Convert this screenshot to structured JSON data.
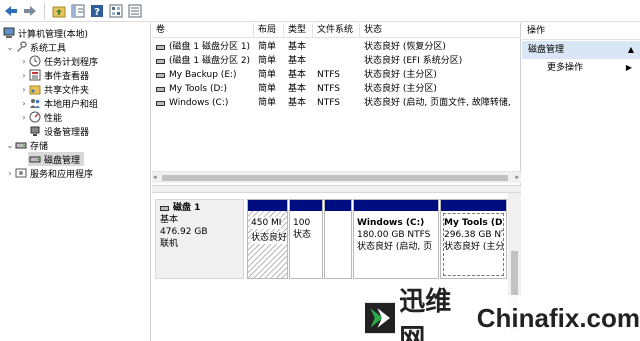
{
  "toolbar": {
    "icons": [
      "back-icon",
      "forward-icon",
      "up-folder-icon",
      "show-hide-tree-icon",
      "help-icon",
      "properties-icon",
      "view-icon"
    ]
  },
  "tree": {
    "root": "计算机管理(本地)",
    "system_tools": "系统工具",
    "task_scheduler": "任务计划程序",
    "event_viewer": "事件查看器",
    "shared_folders": "共享文件夹",
    "local_users": "本地用户和组",
    "performance": "性能",
    "device_manager": "设备管理器",
    "storage": "存储",
    "disk_management": "磁盘管理",
    "services_apps": "服务和应用程序"
  },
  "volumes": {
    "columns": [
      "卷",
      "布局",
      "类型",
      "文件系统",
      "状态"
    ],
    "rows": [
      {
        "name": "(磁盘 1 磁盘分区 1)",
        "layout": "简单",
        "type": "基本",
        "fs": "",
        "status": "状态良好 (恢复分区)"
      },
      {
        "name": "(磁盘 1 磁盘分区 2)",
        "layout": "简单",
        "type": "基本",
        "fs": "",
        "status": "状态良好 (EFI 系统分区)"
      },
      {
        "name": "My Backup (E:)",
        "layout": "简单",
        "type": "基本",
        "fs": "NTFS",
        "status": "状态良好 (主分区)"
      },
      {
        "name": "My Tools (D:)",
        "layout": "简单",
        "type": "基本",
        "fs": "NTFS",
        "status": "状态良好 (主分区)"
      },
      {
        "name": "Windows (C:)",
        "layout": "简单",
        "type": "基本",
        "fs": "NTFS",
        "status": "状态良好 (启动, 页面文件, 故障转储,"
      }
    ]
  },
  "disk": {
    "name": "磁盘 1",
    "type": "基本",
    "size": "476.92 GB",
    "state": "联机"
  },
  "partitions": [
    {
      "title": "",
      "line1": "450 MI",
      "line2": "状态良好"
    },
    {
      "title": "",
      "line1": "100",
      "line2": "状态"
    },
    {
      "title": "",
      "line1": "",
      "line2": ""
    },
    {
      "title": "Windows  (C:)",
      "line1": "180.00 GB NTFS",
      "line2": "状态良好 (启动, 页"
    },
    {
      "title": "My Tools  (D:)",
      "line1": "296.38 GB NTFS",
      "line2": "状态良好 (主分区)"
    }
  ],
  "actions": {
    "header": "操作",
    "section": "磁盘管理",
    "more": "更多操作"
  },
  "watermark": {
    "cn": "迅维网",
    "en": "Chinafix.com"
  },
  "colors": {
    "partition_bar": "#000d80",
    "action_section_bg": "#d9e6f5",
    "selected_tree_bg": "#d9d9d9"
  }
}
